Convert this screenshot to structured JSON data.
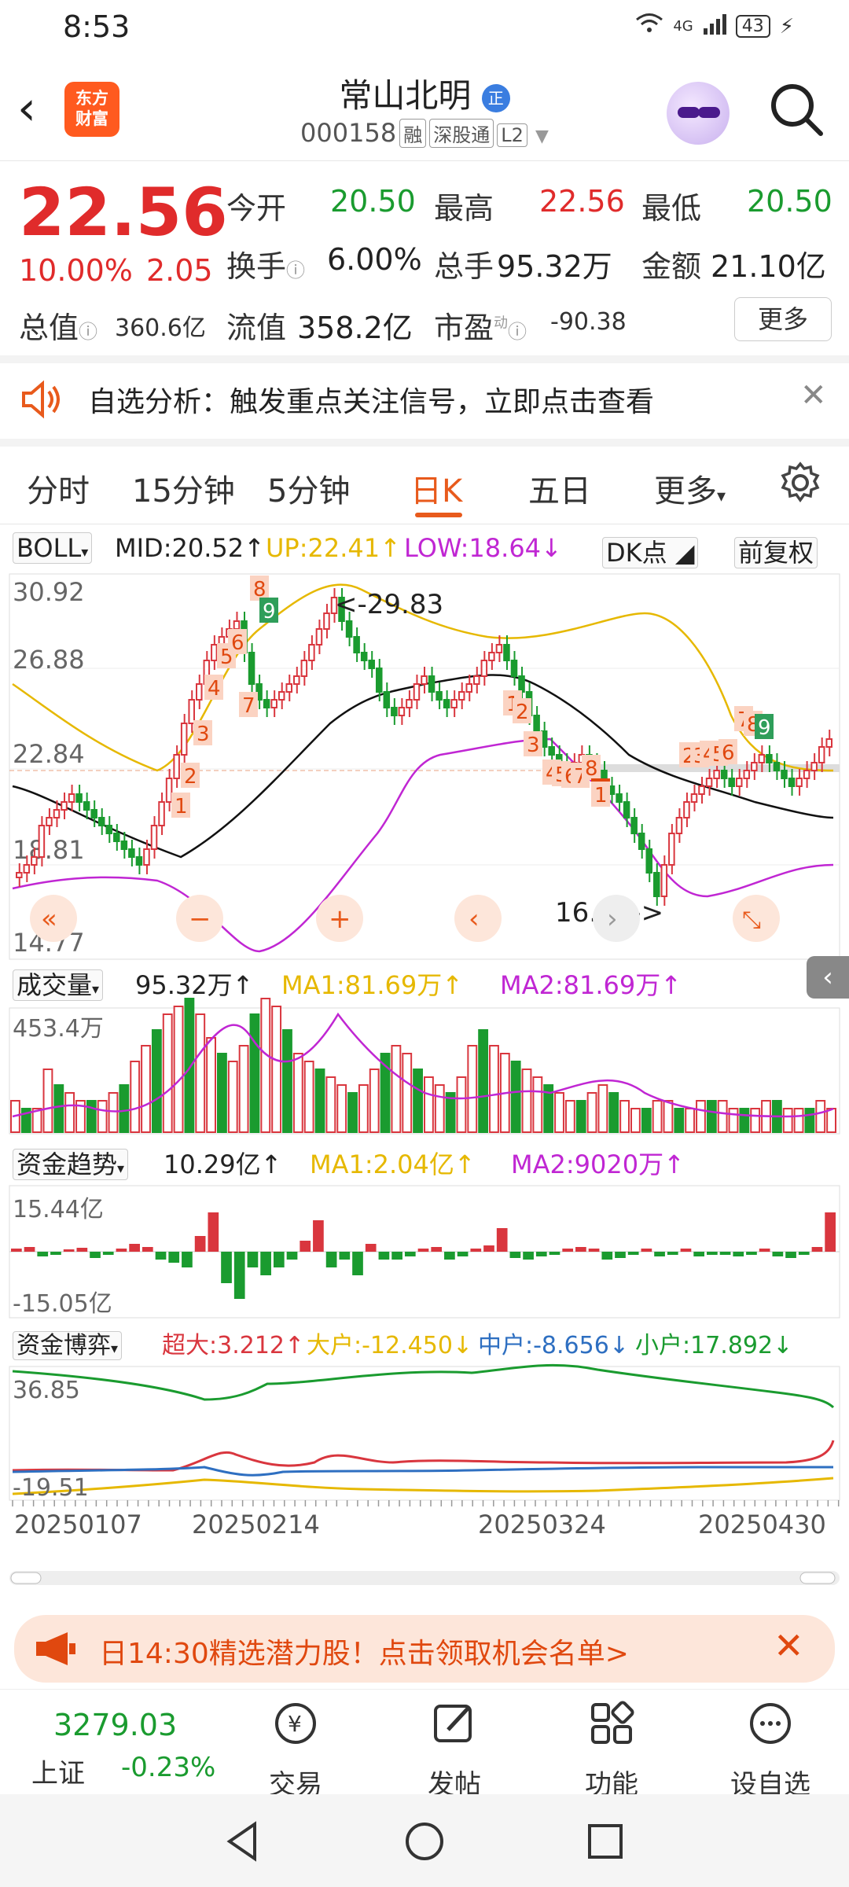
{
  "status": {
    "time": "8:53",
    "network": "4G",
    "battery": "43"
  },
  "header": {
    "logo_line1": "东方",
    "logo_line2": "财富",
    "stock_name": "常山北明",
    "stock_badge": "正",
    "code": "000158",
    "tags": [
      "融",
      "深股通",
      "L2"
    ]
  },
  "quote": {
    "price": "22.56",
    "change_pct": "10.00%",
    "change": "2.05",
    "open_label": "今开",
    "open": "20.50",
    "high_label": "最高",
    "high": "22.56",
    "low_label": "最低",
    "low": "20.50",
    "turnover_label": "换手",
    "turnover": "6.00%",
    "volume_label": "总手",
    "volume": "95.32万",
    "amount_label": "金额",
    "amount": "21.10亿",
    "mktcap_label": "总值",
    "mktcap": "360.6亿",
    "float_label": "流值",
    "float": "358.2亿",
    "pe_label": "市盈",
    "pe_sup": "动",
    "pe": "-90.38",
    "more": "更多"
  },
  "notice": {
    "text": "自选分析：触发重点关注信号，立即点击查看"
  },
  "tabs": {
    "t1": "分时",
    "t2": "15分钟",
    "t3": "5分钟",
    "t4": "日K",
    "t5": "五日",
    "t6": "更多"
  },
  "boll": {
    "name": "BOLL",
    "mid": "MID:20.52↑",
    "up": "UP:22.41↑",
    "low": "LOW:18.64↓",
    "dk": "DK点",
    "fq": "前复权"
  },
  "vol": {
    "name": "成交量",
    "value": "95.32万↑",
    "ma1": "MA1:81.69万↑",
    "ma2": "MA2:81.69万↑",
    "axis_top": "453.4万"
  },
  "fund": {
    "name": "资金趋势",
    "value": "10.29亿↑",
    "ma1": "MA1:2.04亿↑",
    "ma2": "MA2:9020万↑",
    "axis_top": "15.44亿",
    "axis_bottom": "-15.05亿"
  },
  "game": {
    "name": "资金博弈",
    "super": "超大:3.212↑",
    "big": "大户:-12.450↓",
    "mid": "中户:-8.656↓",
    "small": "小户:17.892↓",
    "axis_top": "36.85",
    "axis_bottom": "-19.51"
  },
  "dates": [
    "20250107",
    "20250214",
    "20250324",
    "20250430"
  ],
  "promo": {
    "text": "日14:30精选潜力股！点击领取机会名单>"
  },
  "bottom_nav": {
    "index_value": "3279.03",
    "index_name": "上证",
    "index_change": "-0.23%",
    "trade": "交易",
    "post": "发帖",
    "func": "功能",
    "watch": "设自选"
  },
  "chart_data": {
    "type": "candlestick",
    "y_axis_labels": [
      "30.92",
      "26.88",
      "22.84",
      "18.81",
      "14.77"
    ],
    "ylim": [
      14.77,
      30.92
    ],
    "annotations": [
      "<-29.83",
      "16.62->"
    ],
    "td_counts": [
      "1",
      "2",
      "3",
      "4",
      "5",
      "6",
      "7",
      "8",
      "9",
      "1",
      "2",
      "3",
      "4",
      "5",
      "6",
      "7",
      "8",
      "9",
      "1",
      "2",
      "3",
      "4",
      "5",
      "6",
      "7",
      "8",
      "9"
    ],
    "colors": {
      "up": "#d9363e",
      "down": "#1a9b2f",
      "mid": "#111111",
      "upper": "#e6b800",
      "lower": "#c026d3"
    }
  }
}
